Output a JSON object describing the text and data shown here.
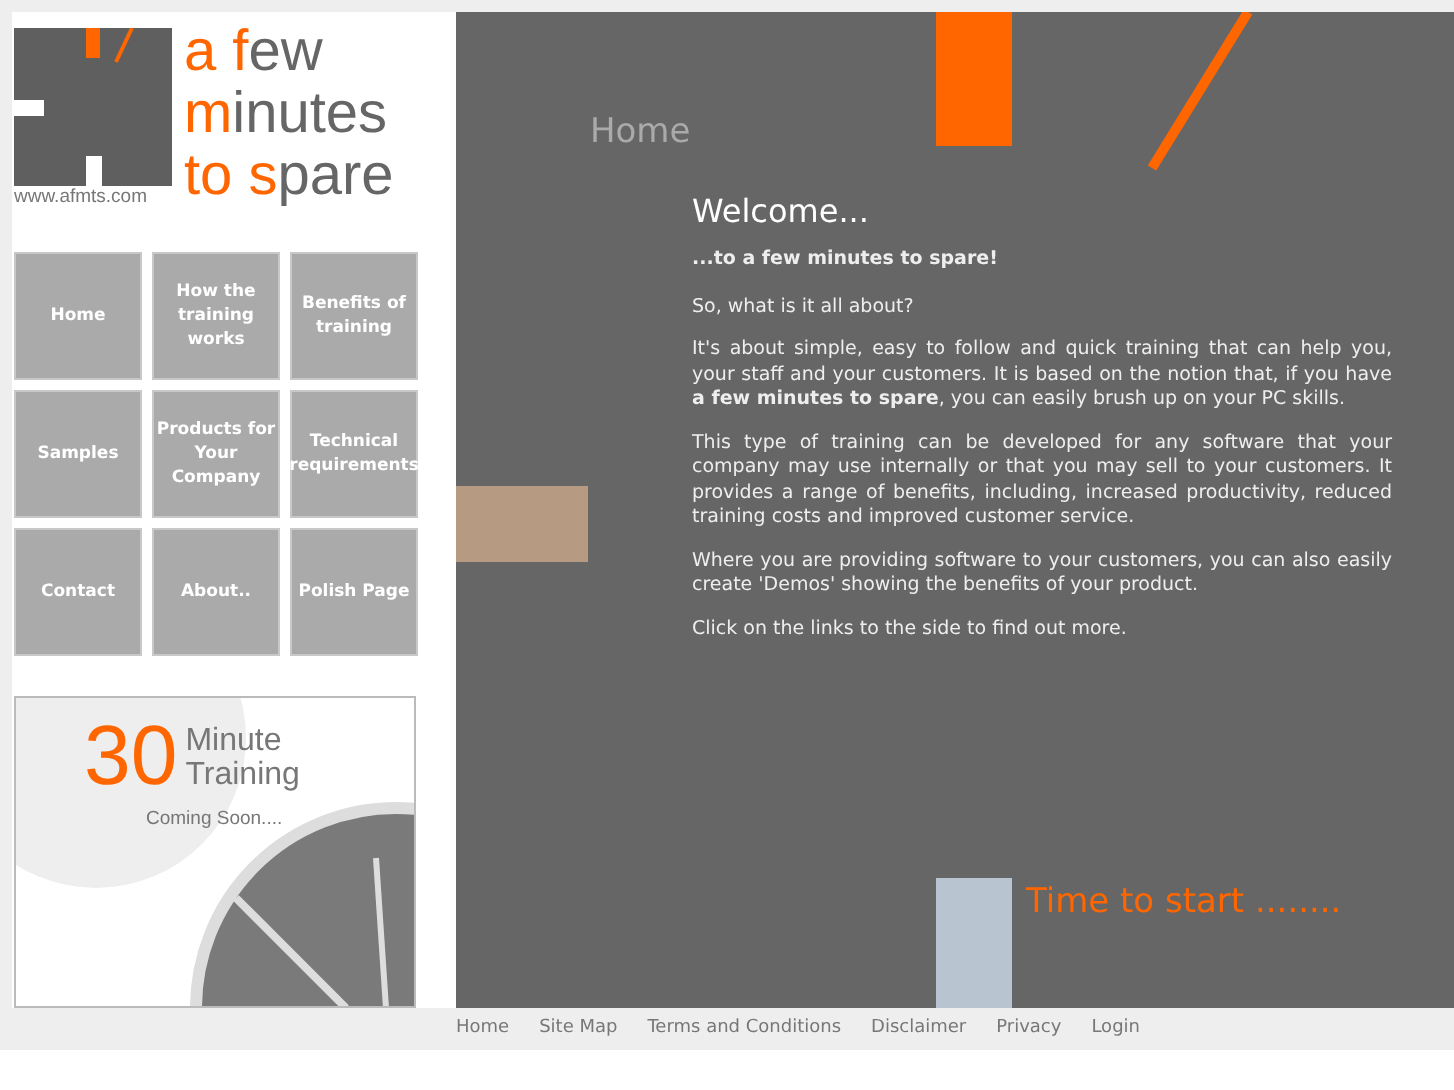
{
  "logo": {
    "lines": [
      [
        {
          "text": "a f",
          "accent": true
        },
        {
          "text": "ew",
          "accent": false
        }
      ],
      [
        {
          "text": "m",
          "accent": true
        },
        {
          "text": "inutes",
          "accent": false
        }
      ],
      [
        {
          "text": "to s",
          "accent": true
        },
        {
          "text": "pare",
          "accent": false
        }
      ]
    ],
    "url": "www.afmts.com"
  },
  "nav": [
    "Home",
    "How the training works",
    "Benefits of training",
    "Samples",
    "Products for Your Company",
    "Technical requirements",
    "Contact",
    "About..",
    "Polish Page"
  ],
  "promo": {
    "number": "30",
    "title": "Minute Training",
    "subtitle": "Coming Soon...."
  },
  "page_title": "Home",
  "content": {
    "heading": "Welcome...",
    "subheading": "...to a few minutes to spare!",
    "paragraphs": [
      "So, what is it all about?",
      "It's about simple, easy to follow and quick training that can help you, your staff and your customers. It is based on the notion that, if you have **a few minutes to spare**, you can easily brush up on your PC skills.",
      "This type of training can be developed for any software that your company may use internally or that you may sell to your customers. It provides a range of benefits, including, increased productivity, reduced training costs and improved customer service.",
      "Where you are providing software to your customers, you can also easily create 'Demos' showing the benefits of your product.",
      "Click on the links to the side to find out more."
    ]
  },
  "cta": "Time to start ........",
  "footer_links": [
    "Home",
    "Site Map",
    "Terms and Conditions",
    "Disclaimer",
    "Privacy",
    "Login"
  ]
}
